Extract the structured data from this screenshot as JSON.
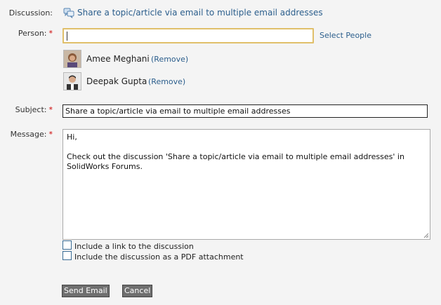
{
  "discussion": {
    "label": "Discussion:",
    "icon": "discussion-icon",
    "title": "Share a topic/article via email to multiple email addresses"
  },
  "person": {
    "label": "Person:",
    "required_mark": "*",
    "input_value": "",
    "select_people": "Select People",
    "recipients": [
      {
        "name": "Amee Meghani",
        "remove": "(Remove)"
      },
      {
        "name": "Deepak Gupta",
        "remove": "(Remove)"
      }
    ]
  },
  "subject": {
    "label": "Subject:",
    "required_mark": "*",
    "value": "Share a topic/article via email to multiple email addresses"
  },
  "message": {
    "label": "Message:",
    "required_mark": "*",
    "line1": "Hi,",
    "line2": "Check out the discussion 'Share a topic/article via email to multiple email addresses' in SolidWorks Forums."
  },
  "options": {
    "include_link": "Include a link to the discussion",
    "include_pdf": "Include the discussion as a PDF attachment"
  },
  "buttons": {
    "send": "Send Email",
    "cancel": "Cancel"
  },
  "colors": {
    "link": "#2b5e8c",
    "required": "#cc0000",
    "focus_border": "#e0bf6a",
    "button_bg": "#6f6f6f"
  }
}
